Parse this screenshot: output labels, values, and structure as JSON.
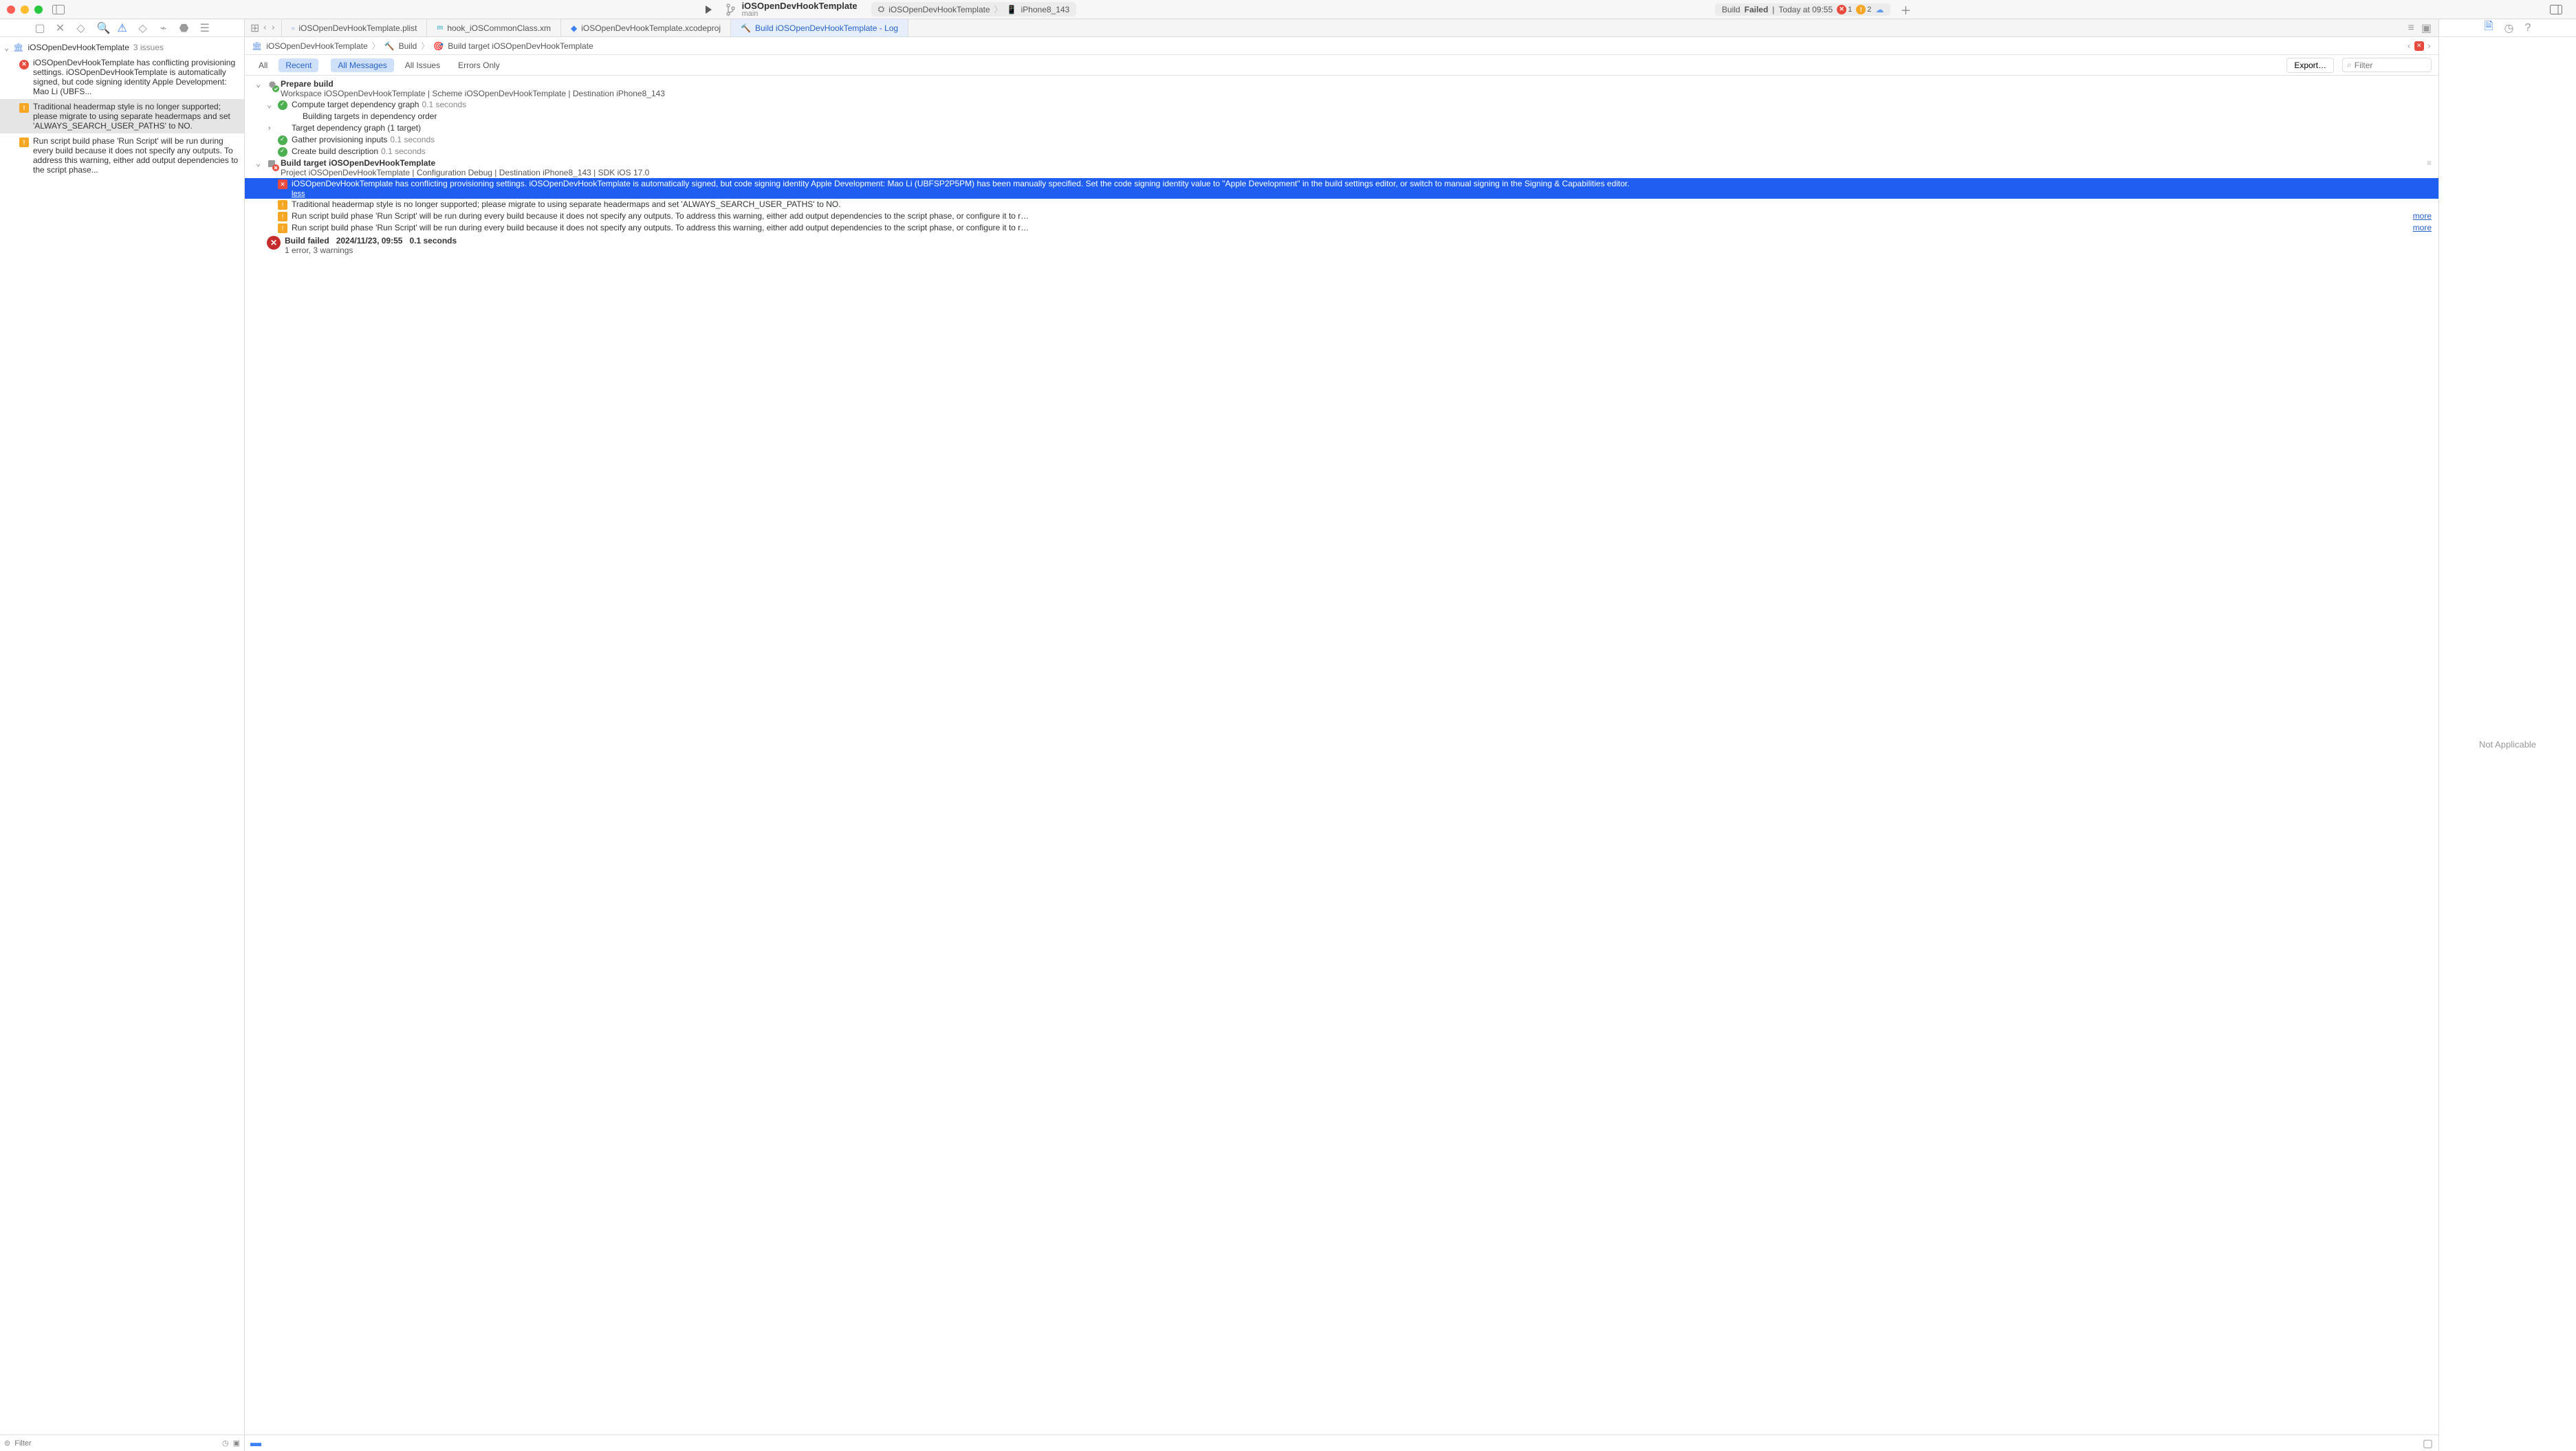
{
  "titlebar": {
    "scheme_name": "iOSOpenDevHookTemplate",
    "scheme_branch": "main",
    "target_scheme": "iOSOpenDevHookTemplate",
    "target_device": "iPhone8_143",
    "status_prefix": "Build",
    "status_result": "Failed",
    "status_sep": "|",
    "status_time": "Today at 09:55",
    "error_count": "1",
    "warning_count": "2"
  },
  "navigator": {
    "project": "iOSOpenDevHookTemplate",
    "count": "3 issues",
    "issues": [
      "iOSOpenDevHookTemplate has conflicting provisioning settings. iOSOpenDevHookTemplate is automatically signed, but code signing identity Apple Development: Mao Li (UBFS...",
      "Traditional headermap style is no longer supported; please migrate to using separate headermaps and set 'ALWAYS_SEARCH_USER_PATHS' to NO.",
      "Run script build phase 'Run Script' will be run during every build because it does not specify any outputs. To address this warning, either add output dependencies to the script phase..."
    ],
    "filter_placeholder": "Filter"
  },
  "tabs": [
    "iOSOpenDevHookTemplate.plist",
    "hook_iOSCommonClass.xm",
    "iOSOpenDevHookTemplate.xcodeproj",
    "Build iOSOpenDevHookTemplate - Log"
  ],
  "breadcrumb": {
    "a": "iOSOpenDevHookTemplate",
    "b": "Build",
    "c": "Build target iOSOpenDevHookTemplate"
  },
  "filterbar": {
    "all": "All",
    "recent": "Recent",
    "all_messages": "All Messages",
    "all_issues": "All Issues",
    "errors_only": "Errors Only",
    "export": "Export…",
    "filter_placeholder": "Filter"
  },
  "log": {
    "prepare_title": "Prepare build",
    "prepare_sub": "Workspace iOSOpenDevHookTemplate | Scheme iOSOpenDevHookTemplate | Destination iPhone8_143",
    "compute_dep": "Compute target dependency graph",
    "compute_dep_time": "0.1 seconds",
    "building_targets": "Building targets in dependency order",
    "target_graph": "Target dependency graph (1 target)",
    "gather": "Gather provisioning inputs",
    "gather_time": "0.1 seconds",
    "create_desc": "Create build description",
    "create_desc_time": "0.1 seconds",
    "build_target_title": "Build target iOSOpenDevHookTemplate",
    "build_target_sub": "Project iOSOpenDevHookTemplate | Configuration Debug | Destination iPhone8_143 | SDK iOS 17.0",
    "err_selected": "iOSOpenDevHookTemplate has conflicting provisioning settings. iOSOpenDevHookTemplate is automatically signed, but code signing identity Apple Development: Mao Li (UBFSP2P5PM) has been manually specified. Set the code signing identity value to \"Apple Development\" in the build settings editor, or switch to manual signing in the Signing & Capabilities editor.",
    "less": "less",
    "warn1": "Traditional headermap style is no longer supported; please migrate to using separate headermaps and set 'ALWAYS_SEARCH_USER_PATHS' to NO.",
    "warn2": "Run script build phase 'Run Script' will be run during every build because it does not specify any outputs. To address this warning, either add output dependencies to the script phase, or configure it to r…",
    "warn3": "Run script build phase 'Run Script' will be run during every build because it does not specify any outputs. To address this warning, either add output dependencies to the script phase, or configure it to r…",
    "more": "more",
    "build_failed": "Build failed",
    "build_failed_time": "2024/11/23, 09:55",
    "build_failed_dur": "0.1 seconds",
    "build_failed_sum": "1 error, 3 warnings"
  },
  "inspector": {
    "placeholder": "Not Applicable"
  }
}
